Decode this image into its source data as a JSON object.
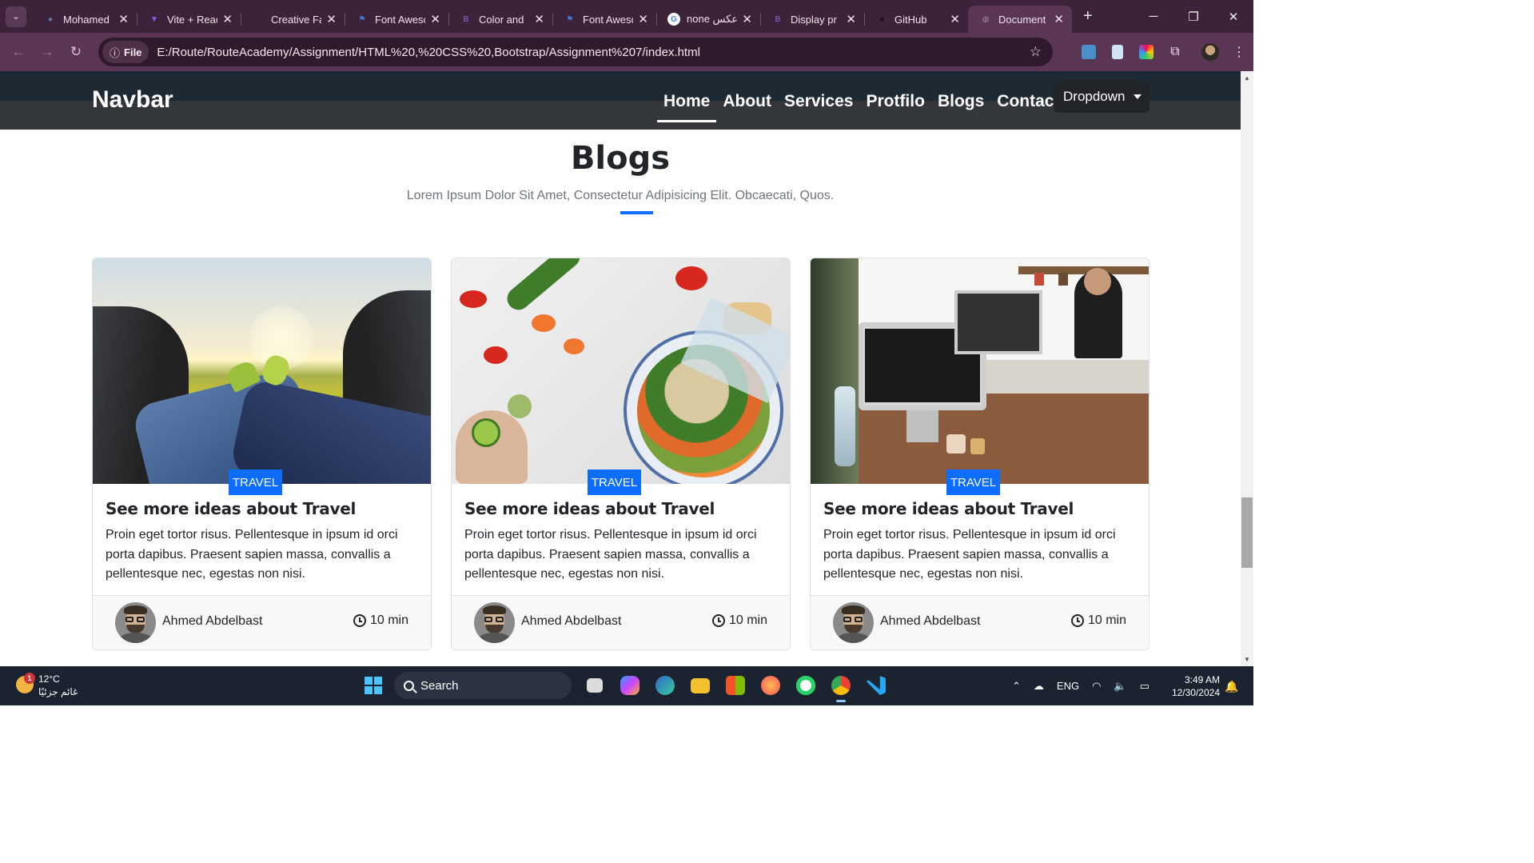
{
  "browser": {
    "tabs": [
      {
        "title": "Mohamed",
        "favicon_color": "#5f7ba6",
        "favicon_glyph": "●"
      },
      {
        "title": "Vite + React",
        "favicon_color": "#8a5cf6",
        "favicon_glyph": "▼"
      },
      {
        "title": "Creative Fa",
        "favicon_color": "#3c2339",
        "favicon_glyph": "✦"
      },
      {
        "title": "Font Awesome",
        "favicon_color": "#3f7bd8",
        "favicon_glyph": "⚑"
      },
      {
        "title": "Color and",
        "favicon_color": "#7952b3",
        "favicon_glyph": "B"
      },
      {
        "title": "Font Awesome",
        "favicon_color": "#3f7bd8",
        "favicon_glyph": "⚑"
      },
      {
        "title": "none عكس",
        "favicon_color": "#ffffff",
        "favicon_glyph": "G"
      },
      {
        "title": "Display pr",
        "favicon_color": "#7952b3",
        "favicon_glyph": "B"
      },
      {
        "title": "GitHub",
        "favicon_color": "#111111",
        "favicon_glyph": "●"
      },
      {
        "title": "Document",
        "favicon_color": "#9a8a98",
        "favicon_glyph": "◍"
      }
    ],
    "active_tab_index": 9,
    "new_tab_glyph": "+",
    "close_glyph": "✕",
    "url_chip": "File",
    "url": "E:/Route/RouteAcademy/Assignment/HTML%20,%20CSS%20,Bootstrap/Assignment%207/index.html"
  },
  "site": {
    "brand": "Navbar",
    "menu": [
      "Home",
      "About",
      "Services",
      "Protfilo",
      "Blogs",
      "Contact"
    ],
    "active_menu": "Home",
    "dropdown_label": "Dropdown",
    "section_title": "Blogs",
    "section_subtitle": "Lorem Ipsum Dolor Sit Amet, Consectetur Adipisicing Elit. Obcaecati, Quos.",
    "accent_color": "#0d6efd",
    "cards": [
      {
        "image": "road-trip-feet-field",
        "badge": "TRAVEL",
        "title": "See more ideas about Travel",
        "text": "Proin eget tortor risus. Pellentesque in ipsum id orci porta dapibus. Praesent sapien massa, convallis a pellentesque nec, egestas non nisi.",
        "author": "Ahmed Abdelbast",
        "read_time": "10 min"
      },
      {
        "image": "vegetable-salad-bowl",
        "badge": "TRAVEL",
        "title": "See more ideas about Travel",
        "text": "Proin eget tortor risus. Pellentesque in ipsum id orci porta dapibus. Praesent sapien massa, convallis a pellentesque nec, egestas non nisi.",
        "author": "Ahmed Abdelbast",
        "read_time": "10 min"
      },
      {
        "image": "office-desk-imac",
        "badge": "TRAVEL",
        "title": "See more ideas about Travel",
        "text": "Proin eget tortor risus. Pellentesque in ipsum id orci porta dapibus. Praesent sapien massa, convallis a pellentesque nec, egestas non nisi.",
        "author": "Ahmed Abdelbast",
        "read_time": "10 min"
      }
    ]
  },
  "taskbar": {
    "weather_temp": "12°C",
    "weather_desc": "غائم جزئيًا",
    "weather_badge": "1",
    "search_label": "Search",
    "language": "ENG",
    "time": "3:49 AM",
    "date": "12/30/2024"
  }
}
